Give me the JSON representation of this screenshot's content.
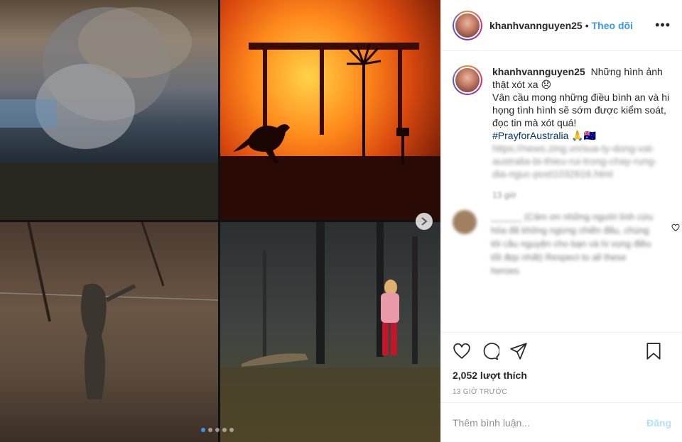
{
  "header": {
    "username": "khanhvannguyen25",
    "separator": "•",
    "follow_label": "Theo dõi",
    "more_label": "•••"
  },
  "caption": {
    "username": "khanhvannguyen25",
    "line1": "Những hình ảnh thật xót xa 😞",
    "line2": "Vân cầu mong những điều bình an và hi họng tình hình sẽ sớm được kiểm soát, đọc tin mà xót quá!",
    "hashtag": "#PrayforAustralia",
    "emoji": "🙏🇦🇺",
    "link": "https://news.zing.vn/sua-ty-dong-vat-australia-bi-thieu-rui-trong-chay-rung-dia-nguc-post1032616.html",
    "time": "13 giờ"
  },
  "comment2": {
    "text": "______ (Cảm ơn những người lính cứu hỏa đã không ngừng chiến đấu, chúng tôi cầu nguyện cho bạn và hi vọng điều tốt đẹp nhất) Respect to all these heroes"
  },
  "actions": {
    "likes": "2,052 lượt thích",
    "time_ago": "13 GIỜ TRƯỚC"
  },
  "comment_box": {
    "placeholder": "Thêm bình luận...",
    "post_label": "Đăng"
  },
  "carousel": {
    "dot_count": 5,
    "active_index": 0
  }
}
